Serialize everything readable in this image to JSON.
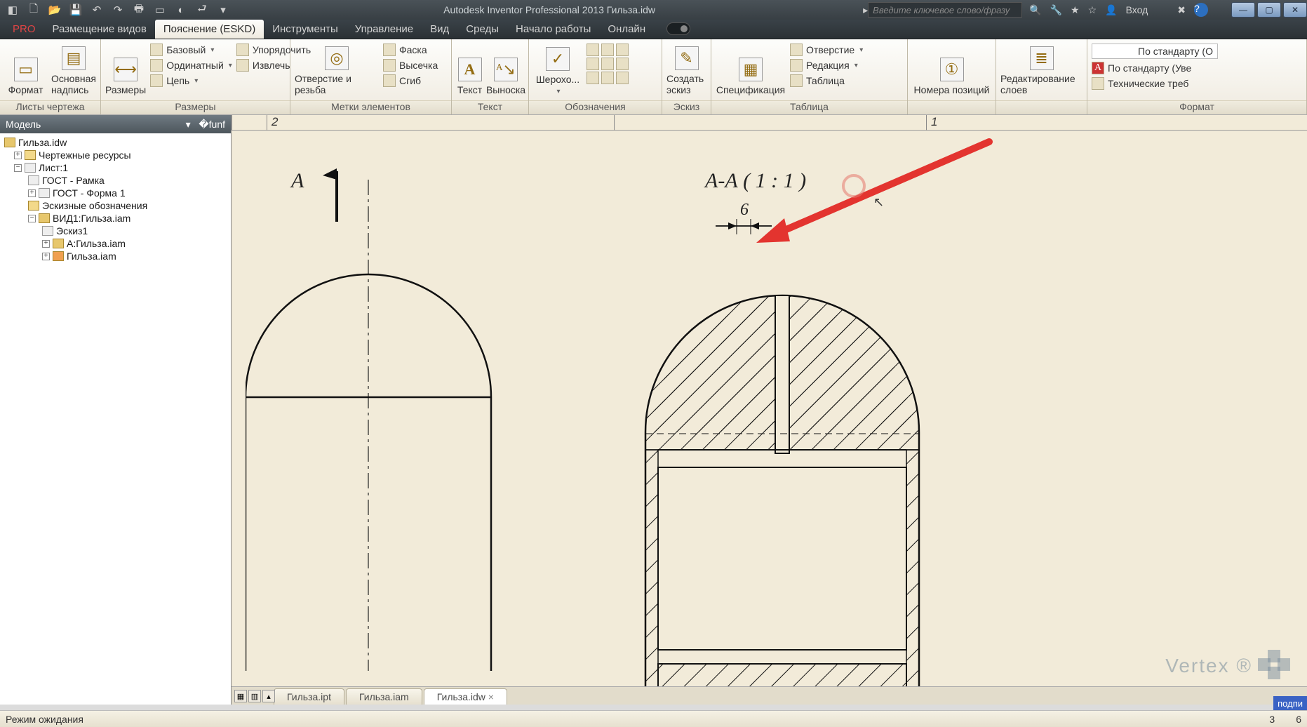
{
  "title": "Autodesk Inventor Professional 2013    Гильза.idw",
  "search_placeholder": "Введите ключевое слово/фразу",
  "signin": "Вход",
  "tabs": {
    "pro": "PRO",
    "views": "Размещение видов",
    "annot": "Пояснение (ESKD)",
    "tools": "Инструменты",
    "manage": "Управление",
    "view": "Вид",
    "env": "Среды",
    "start": "Начало работы",
    "online": "Онлайн"
  },
  "panels": {
    "sheets": {
      "label": "Листы чертежа",
      "format": "Формат",
      "main": "Основная надпись"
    },
    "dims": {
      "label": "Размеры",
      "dim": "Размеры",
      "base": "Базовый",
      "ord": "Ординатный",
      "chain": "Цепь",
      "arrange": "Упорядочить",
      "retrieve": "Извлечь"
    },
    "feat": {
      "label": "Метки элементов",
      "hole": "Отверстие и резьба",
      "chamfer": "Фаска",
      "punch": "Высечка",
      "bend": "Сгиб"
    },
    "text": {
      "label": "Текст",
      "text": "Текст",
      "leader": "Выноска"
    },
    "sym": {
      "label": "Обозначения",
      "rough": "Шерохо..."
    },
    "sketch": {
      "label": "Эскиз",
      "create": "Создать эскиз"
    },
    "table": {
      "label": "Таблица",
      "parts": "Спецификация",
      "hole": "Отверстие",
      "rev": "Редакция",
      "gen": "Таблица"
    },
    "balloon": {
      "num": "Номера позиций"
    },
    "layers": {
      "edit": "Редактирование слоев"
    },
    "fmt": {
      "label": "Формат",
      "std1": "По стандарту (О",
      "std2": "По стандарту (Уве",
      "tech": "Технические треб"
    }
  },
  "browser": {
    "header": "Модель",
    "root": "Гильза.idw",
    "res": "Чертежные ресурсы",
    "sheet": "Лист:1",
    "frame": "ГОСТ - Рамка",
    "form": "ГОСТ - Форма 1",
    "skobозн": "Эскизные обозначения",
    "view1": "ВИД1:Гильза.iam",
    "sketch1": "Эскиз1",
    "sectA": "А:Гильза.iam",
    "asm": "Гильза.iam"
  },
  "ruler": {
    "z2": "2",
    "z1": "1"
  },
  "drawing": {
    "marker": "А",
    "section": "А-А ( 1 : 1 )",
    "dim6": "6"
  },
  "doc_tabs": {
    "ipt": "Гильза.ipt",
    "iam": "Гильза.iam",
    "idw": "Гильза.idw"
  },
  "status": {
    "msg": "Режим ожидания",
    "n1": "3",
    "n2": "6"
  },
  "chip": "подпи",
  "watermark": "Vertex ®"
}
